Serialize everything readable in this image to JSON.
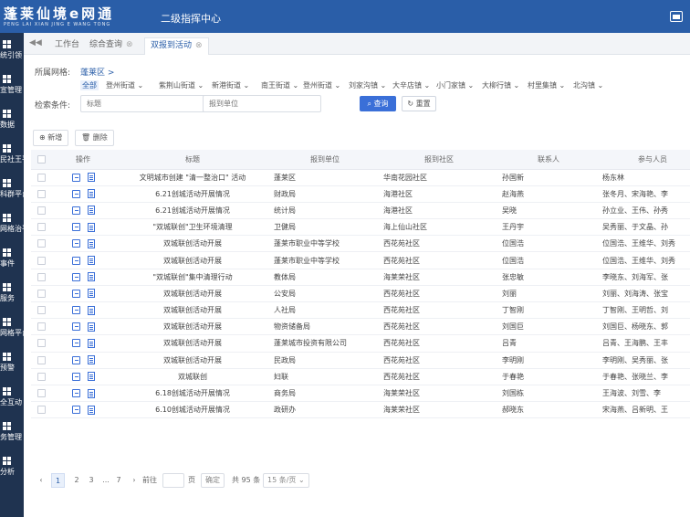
{
  "header": {
    "logo_main": "蓬莱仙境e网通",
    "logo_sub": "PENG LAI XIAN JING E WANG TONG",
    "system_title": "二级指挥中心"
  },
  "sidebar": {
    "items": [
      {
        "label": "统引领",
        "icon": "grid-icon"
      },
      {
        "label": "宣管理",
        "icon": "grid-icon"
      },
      {
        "label": "数据",
        "icon": "chart-icon"
      },
      {
        "label": "民社王平台",
        "icon": "doc-icon"
      },
      {
        "label": "科群平台",
        "icon": "grid-icon"
      },
      {
        "label": "网格治平台",
        "icon": "grid-icon"
      },
      {
        "label": "事件",
        "icon": "grid-icon"
      },
      {
        "label": "服务",
        "icon": "grid-icon"
      },
      {
        "label": "网格平台",
        "icon": "grid-icon"
      },
      {
        "label": "预警",
        "icon": "grid-icon"
      },
      {
        "label": "全互动",
        "icon": "grid-icon"
      },
      {
        "label": "务管理",
        "icon": "grid-icon"
      },
      {
        "label": "分析",
        "icon": "grid-icon"
      }
    ]
  },
  "tabs": [
    {
      "label": "工作台",
      "closable": false
    },
    {
      "label": "综合查询",
      "closable": true
    },
    {
      "label": "双报到活动",
      "closable": true,
      "active": true
    }
  ],
  "filters": {
    "grid_label": "所属网格:",
    "grid_value": "蓬莱区 >",
    "grid_options": [
      "全部",
      "登州街道",
      "紫荆山街道",
      "新港街道",
      "南王街道",
      "登州街道",
      "刘家沟镇",
      "大辛店镇",
      "小门家镇",
      "大柳行镇",
      "村里集镇",
      "北沟镇"
    ],
    "title_label": "检索条件:",
    "title_placeholder": "标题",
    "unit_placeholder": "报到单位",
    "search_label": "查询",
    "reset_label": "重置"
  },
  "toolbar": {
    "add_label": "新增",
    "delete_label": "删除"
  },
  "table": {
    "columns": [
      "操作",
      "标题",
      "报到单位",
      "报到社区",
      "联系人",
      "参与人员"
    ],
    "rows": [
      {
        "title": "文明城市创建 \"清一整治口\" 活动",
        "unit": "蓬莱区",
        "community": "华南花园社区",
        "contact": "孙国新",
        "participants": "杨东林"
      },
      {
        "title": "6.21创城活动开展情况",
        "unit": "财政局",
        "community": "海港社区",
        "contact": "赵海燕",
        "participants": "张冬月、宋海艳、李"
      },
      {
        "title": "6.21创城活动开展情况",
        "unit": "统计局",
        "community": "海港社区",
        "contact": "吴晓",
        "participants": "孙立业、王伟、孙秀"
      },
      {
        "title": "\"双城联创\"卫生环境清理",
        "unit": "卫健局",
        "community": "海上仙山社区",
        "contact": "王丹宇",
        "participants": "吴秀丽、于文晶、孙"
      },
      {
        "title": "双城联创活动开展",
        "unit": "蓬莱市职业中等学校",
        "community": "西花苑社区",
        "contact": "位国浩",
        "participants": "位国浩、王维华、刘秀"
      },
      {
        "title": "双城联创活动开展",
        "unit": "蓬莱市职业中等学校",
        "community": "西花苑社区",
        "contact": "位国浩",
        "participants": "位国浩、王维华、刘秀"
      },
      {
        "title": "\"双城联创\"集中清理行动",
        "unit": "教体局",
        "community": "海莱荣社区",
        "contact": "张忠敏",
        "participants": "李晓东、刘海军、张"
      },
      {
        "title": "双城联创活动开展",
        "unit": "公安局",
        "community": "西花苑社区",
        "contact": "刘丽",
        "participants": "刘丽、刘海涛、张宝"
      },
      {
        "title": "双城联创活动开展",
        "unit": "人社局",
        "community": "西花苑社区",
        "contact": "丁智刚",
        "participants": "丁智刚、王明哲、刘"
      },
      {
        "title": "双城联创活动开展",
        "unit": "物资储备局",
        "community": "西花苑社区",
        "contact": "刘国巨",
        "participants": "刘国巨、杨晓东、郭"
      },
      {
        "title": "双城联创活动开展",
        "unit": "蓬莱城市投资有限公司",
        "community": "西花苑社区",
        "contact": "吕青",
        "participants": "吕青、王海鹏、王丰"
      },
      {
        "title": "双城联创活动开展",
        "unit": "民政局",
        "community": "西花苑社区",
        "contact": "李明刚",
        "participants": "李明刚、吴秀丽、张"
      },
      {
        "title": "双城联创",
        "unit": "妇联",
        "community": "西花苑社区",
        "contact": "于春艳",
        "participants": "于春艳、张晓兰、李"
      },
      {
        "title": "6.18创城活动开展情况",
        "unit": "商务局",
        "community": "海莱荣社区",
        "contact": "刘国栋",
        "participants": "王海波、刘雪、李"
      },
      {
        "title": "6.10创城活动开展情况",
        "unit": "政研办",
        "community": "海莱荣社区",
        "contact": "郝晓东",
        "participants": "宋海燕、吕新明、王"
      }
    ]
  },
  "pager": {
    "pages": [
      "1",
      "2",
      "3",
      "...",
      "7"
    ],
    "goto_label": "前往",
    "page_unit": "页",
    "confirm_label": "确定",
    "total_text": "共 95 条",
    "page_size": "15 条/页"
  }
}
